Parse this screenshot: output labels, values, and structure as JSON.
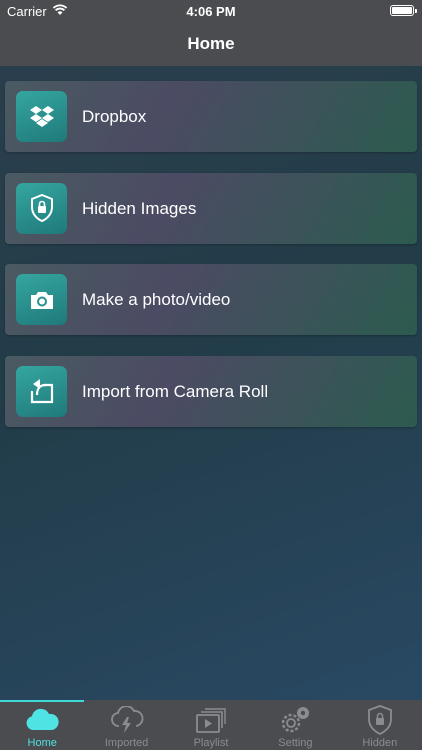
{
  "status_bar": {
    "carrier": "Carrier",
    "time": "4:06 PM"
  },
  "nav": {
    "title": "Home"
  },
  "menu": {
    "items": [
      {
        "label": "Dropbox",
        "icon": "dropbox-icon"
      },
      {
        "label": "Hidden Images",
        "icon": "shield-lock-icon"
      },
      {
        "label": "Make a photo/video",
        "icon": "camera-icon"
      },
      {
        "label": "Import from Camera Roll",
        "icon": "import-icon"
      }
    ]
  },
  "tab_bar": {
    "tabs": [
      {
        "label": "Home",
        "icon": "cloud-icon",
        "active": true
      },
      {
        "label": "Imported",
        "icon": "cloud-lightning-icon",
        "active": false
      },
      {
        "label": "Playlist",
        "icon": "playlist-icon",
        "active": false
      },
      {
        "label": "Setting",
        "icon": "gear-icon",
        "active": false
      },
      {
        "label": "Hidden",
        "icon": "shield-lock-icon",
        "active": false
      }
    ]
  },
  "colors": {
    "accent": "#3fd9d9",
    "bar_background": "#4a4c4f",
    "icon_tile": "#2a9090"
  }
}
